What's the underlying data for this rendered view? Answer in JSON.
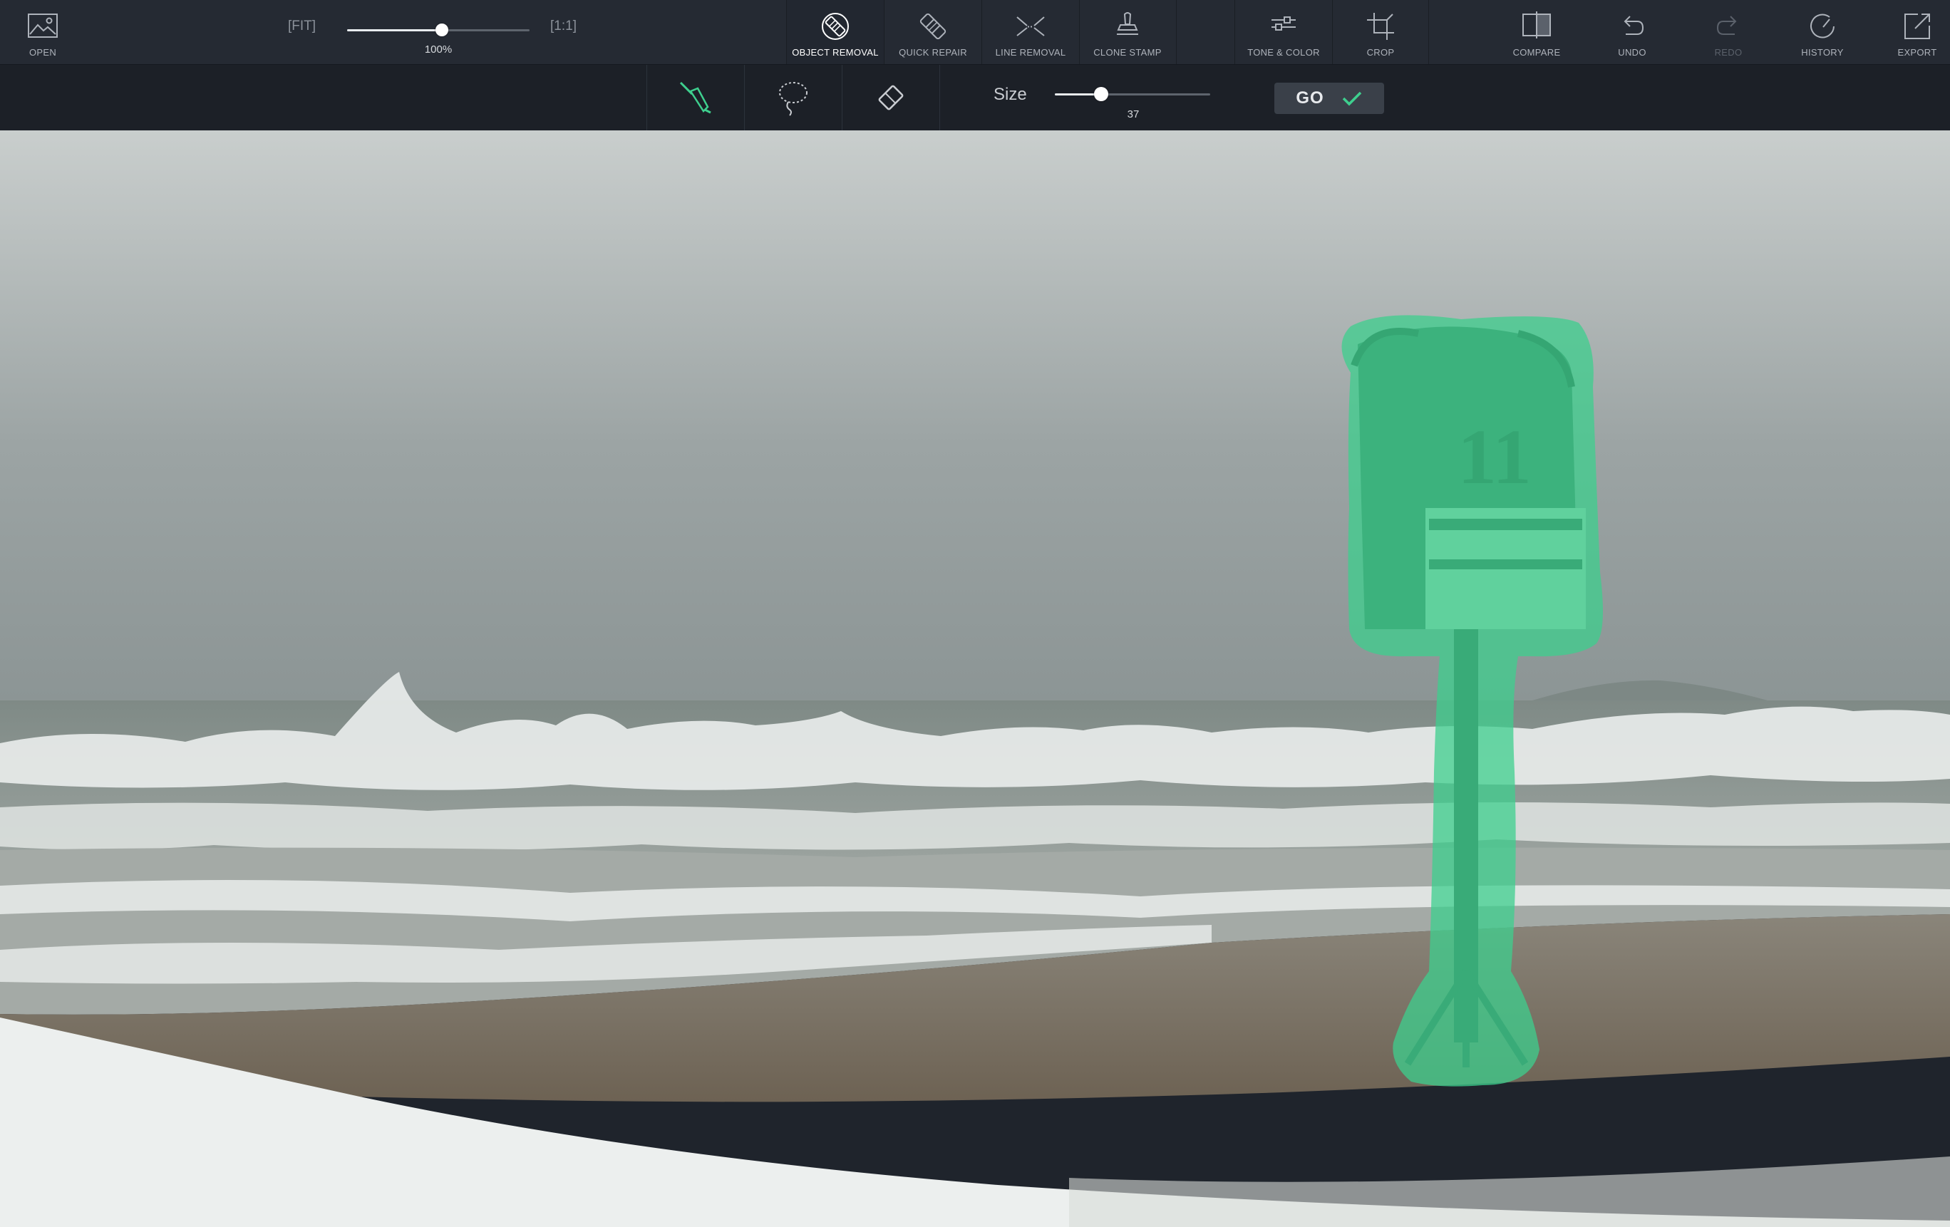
{
  "toolbar": {
    "open_label": "OPEN",
    "zoom": {
      "fit_label": "[FIT]",
      "one_to_one_label": "[1:1]",
      "value_label": "100%",
      "level": 0.52
    },
    "tools": {
      "object_removal": "OBJECT REMOVAL",
      "quick_repair": "QUICK REPAIR",
      "line_removal": "LINE REMOVAL",
      "clone_stamp": "CLONE STAMP",
      "tone_color": "TONE & COLOR",
      "crop": "CROP",
      "compare": "COMPARE",
      "undo": "UNDO",
      "redo": "REDO",
      "history": "HISTORY",
      "export": "EXPORT"
    },
    "active_tool": "object_removal"
  },
  "subtoolbar": {
    "tools": [
      "brush-icon",
      "lasso-icon",
      "eraser-icon"
    ],
    "active_subtool": "brush",
    "size_label": "Size",
    "size_value": "37",
    "size_level": 0.3,
    "go_label": "GO"
  },
  "canvas": {
    "sign_numerals": "11",
    "selection_color": "#3ecf8e",
    "accent_color": "#3ecf8e"
  }
}
